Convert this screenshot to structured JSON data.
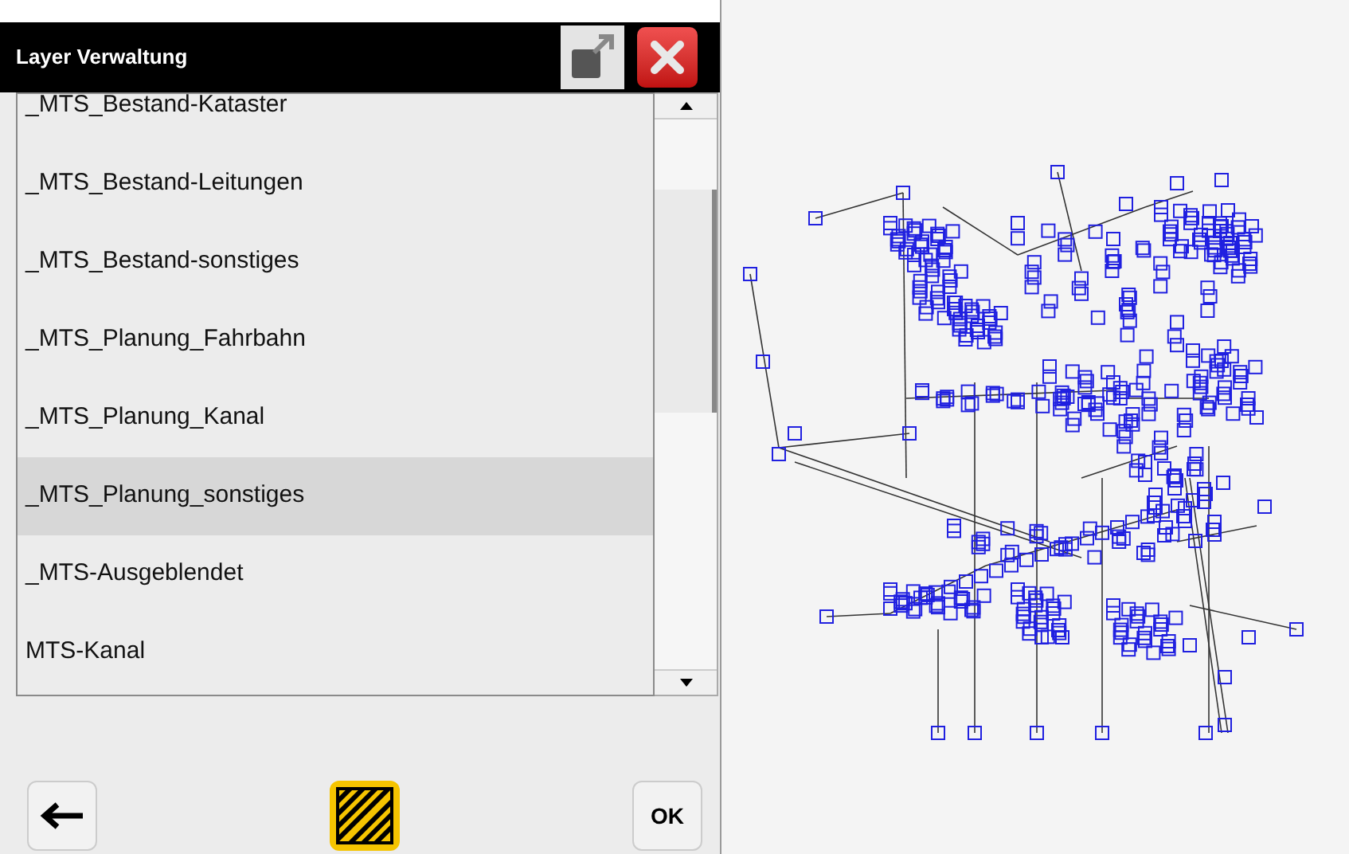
{
  "dialog": {
    "title": "Layer Verwaltung"
  },
  "layers": [
    {
      "label": "_MTS_Bestand-Kataster",
      "selected": false
    },
    {
      "label": "_MTS_Bestand-Leitungen",
      "selected": false
    },
    {
      "label": "_MTS_Bestand-sonstiges",
      "selected": false
    },
    {
      "label": "_MTS_Planung_Fahrbahn",
      "selected": false
    },
    {
      "label": "_MTS_Planung_Kanal",
      "selected": false
    },
    {
      "label": "_MTS_Planung_sonstiges",
      "selected": true
    },
    {
      "label": "_MTS-Ausgeblendet",
      "selected": false
    },
    {
      "label": "MTS-Kanal",
      "selected": false
    }
  ],
  "buttons": {
    "ok": "OK"
  }
}
